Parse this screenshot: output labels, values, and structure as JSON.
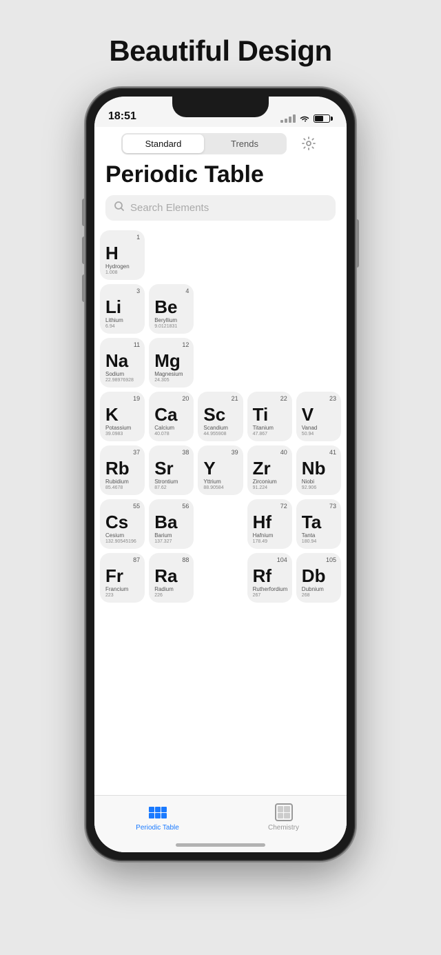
{
  "page": {
    "headline": "Beautiful Design"
  },
  "status_bar": {
    "time": "18:51"
  },
  "segment": {
    "options": [
      "Standard",
      "Trends"
    ],
    "active": 0
  },
  "app": {
    "title": "Periodic Table",
    "search_placeholder": "Search Elements"
  },
  "elements": [
    {
      "number": 1,
      "symbol": "H",
      "name": "Hydrogen",
      "mass": "1.008",
      "col": 1,
      "row": 1
    },
    {
      "number": 3,
      "symbol": "Li",
      "name": "Lithium",
      "mass": "6.94",
      "col": 1,
      "row": 2
    },
    {
      "number": 4,
      "symbol": "Be",
      "name": "Beryllium",
      "mass": "9.0121831",
      "col": 2,
      "row": 2
    },
    {
      "number": 11,
      "symbol": "Na",
      "name": "Sodium",
      "mass": "22.98976928",
      "col": 1,
      "row": 3
    },
    {
      "number": 12,
      "symbol": "Mg",
      "name": "Magnesium",
      "mass": "24.305",
      "col": 2,
      "row": 3
    },
    {
      "number": 19,
      "symbol": "K",
      "name": "Potassium",
      "mass": "39.0983",
      "col": 1,
      "row": 4
    },
    {
      "number": 20,
      "symbol": "Ca",
      "name": "Calcium",
      "mass": "40.078",
      "col": 2,
      "row": 4
    },
    {
      "number": 21,
      "symbol": "Sc",
      "name": "Scandium",
      "mass": "44.955908",
      "col": 3,
      "row": 4
    },
    {
      "number": 22,
      "symbol": "Ti",
      "name": "Titanium",
      "mass": "47.867",
      "col": 4,
      "row": 4
    },
    {
      "number": 23,
      "symbol": "V",
      "name": "Vanadium",
      "mass": "50.94",
      "col": 5,
      "row": 4
    },
    {
      "number": 37,
      "symbol": "Rb",
      "name": "Rubidium",
      "mass": "85.4678",
      "col": 1,
      "row": 5
    },
    {
      "number": 38,
      "symbol": "Sr",
      "name": "Strontium",
      "mass": "87.62",
      "col": 2,
      "row": 5
    },
    {
      "number": 39,
      "symbol": "Y",
      "name": "Yttrium",
      "mass": "88.90584",
      "col": 3,
      "row": 5
    },
    {
      "number": 40,
      "symbol": "Zr",
      "name": "Zirconium",
      "mass": "91.224",
      "col": 4,
      "row": 5
    },
    {
      "number": 41,
      "symbol": "Nb",
      "name": "Niobium",
      "mass": "92.906",
      "col": 5,
      "row": 5
    },
    {
      "number": 55,
      "symbol": "Cs",
      "name": "Cesium",
      "mass": "132.90545196",
      "col": 1,
      "row": 6
    },
    {
      "number": 56,
      "symbol": "Ba",
      "name": "Barium",
      "mass": "137.327",
      "col": 2,
      "row": 6
    },
    {
      "number": 72,
      "symbol": "Hf",
      "name": "Hafnium",
      "mass": "178.49",
      "col": 4,
      "row": 6
    },
    {
      "number": 73,
      "symbol": "Ta",
      "name": "Tantalum",
      "mass": "180.94",
      "col": 5,
      "row": 6
    },
    {
      "number": 87,
      "symbol": "Fr",
      "name": "Francium",
      "mass": "223",
      "col": 1,
      "row": 7
    },
    {
      "number": 88,
      "symbol": "Ra",
      "name": "Radium",
      "mass": "226",
      "col": 2,
      "row": 7
    },
    {
      "number": 104,
      "symbol": "Rf",
      "name": "Rutherfordium",
      "mass": "267",
      "col": 4,
      "row": 7
    },
    {
      "number": 105,
      "symbol": "Db",
      "name": "Dubnium",
      "mass": "268",
      "col": 5,
      "row": 7
    }
  ],
  "tabs": [
    {
      "label": "Periodic Table",
      "active": true
    },
    {
      "label": "Chemistry",
      "active": false
    }
  ]
}
